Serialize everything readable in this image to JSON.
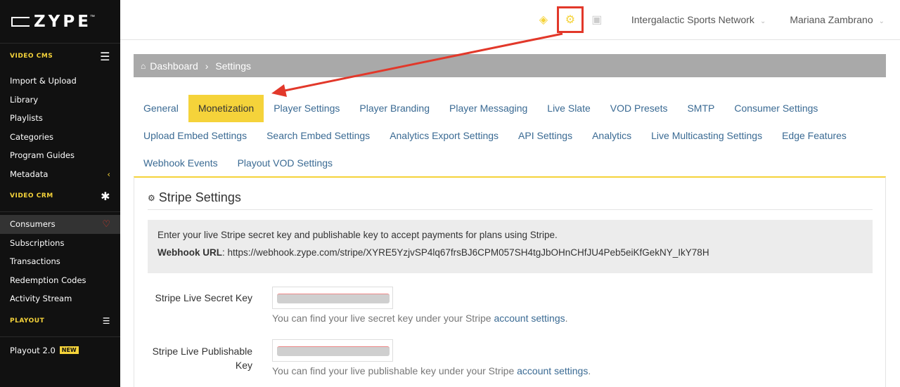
{
  "sidebar": {
    "logo": "ZYPE",
    "logo_tm": "™",
    "sections": [
      {
        "title": "VIDEO CMS",
        "items": [
          "Import & Upload",
          "Library",
          "Playlists",
          "Categories",
          "Program Guides",
          "Metadata"
        ]
      },
      {
        "title": "VIDEO CRM",
        "items": [
          "Consumers",
          "Subscriptions",
          "Transactions",
          "Redemption Codes",
          "Activity Stream"
        ]
      },
      {
        "title": "PLAYOUT",
        "items": [
          "Playout 2.0"
        ]
      }
    ],
    "new_badge": "NEW"
  },
  "topbar": {
    "organization": "Intergalactic Sports Network",
    "user": "Mariana Zambrano"
  },
  "breadcrumb": {
    "home": "Dashboard",
    "current": "Settings"
  },
  "tabs": {
    "row1": [
      "General",
      "Monetization",
      "Player Settings",
      "Player Branding",
      "Player Messaging",
      "Live Slate",
      "VOD Presets",
      "SMTP",
      "Consumer Settings"
    ],
    "row2": [
      "Upload Embed Settings",
      "Search Embed Settings",
      "Analytics Export Settings",
      "API Settings",
      "Analytics",
      "Live Multicasting Settings",
      "Edge Features"
    ],
    "row3": [
      "Webhook Events",
      "Playout VOD Settings"
    ],
    "active": "Monetization"
  },
  "stripe": {
    "title": "Stripe Settings",
    "info_text": "Enter your live Stripe secret key and publishable key to accept payments for plans using Stripe.",
    "webhook_label": "Webhook URL",
    "webhook_url": ": https://webhook.zype.com/stripe/XYRE5YzjvSP4lq67frsBJ6CPM057SH4tgJbOHnCHfJU4Peb5eiKfGekNY_IkY78H",
    "secret_label": "Stripe Live Secret Key",
    "secret_help": "You can find your live secret key under your Stripe ",
    "publishable_label": "Stripe Live Publishable Key",
    "publishable_help": "You can find your live publishable key under your Stripe ",
    "account_link": "account settings",
    "period": "."
  },
  "colors": {
    "accent": "#f5d33a",
    "annotation": "#e2382a",
    "link": "#3a6a93"
  }
}
